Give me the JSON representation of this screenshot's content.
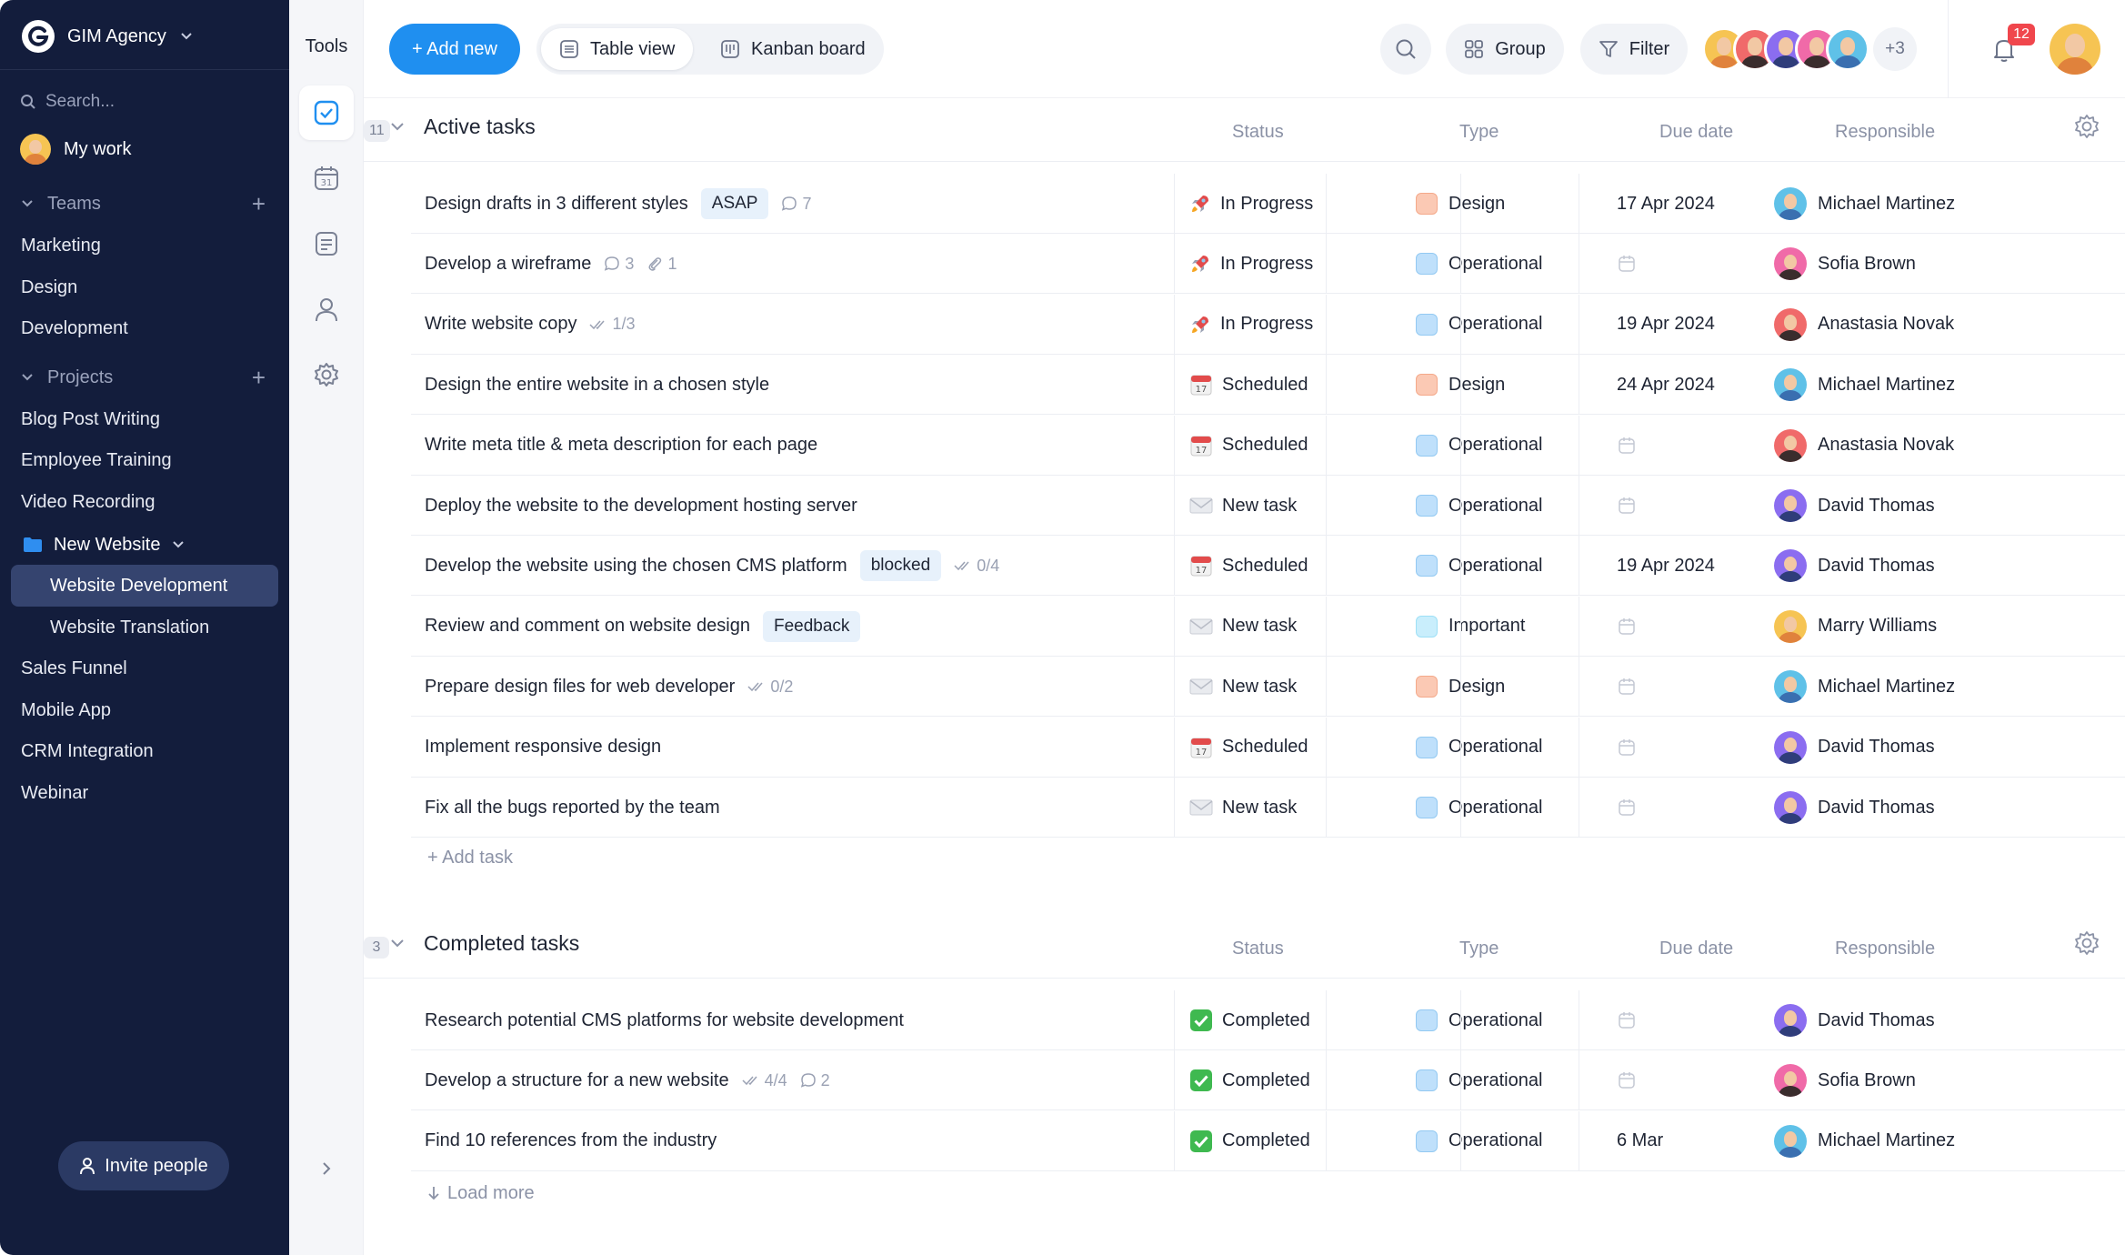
{
  "workspace": {
    "name": "GIM Agency"
  },
  "sidebar": {
    "search_placeholder": "Search...",
    "my_work": "My work",
    "teams_label": "Teams",
    "teams": [
      "Marketing",
      "Design",
      "Development"
    ],
    "projects_label": "Projects",
    "projects_top": [
      "Blog Post Writing",
      "Employee Training",
      "Video Recording"
    ],
    "folder": {
      "name": "New Website",
      "children": [
        "Website Development",
        "Website Translation"
      ],
      "active": "Website Development"
    },
    "projects_bottom": [
      "Sales Funnel",
      "Mobile App",
      "CRM Integration",
      "Webinar"
    ],
    "invite_label": "Invite people"
  },
  "tools": {
    "title": "Tools"
  },
  "topbar": {
    "add_new": "+ Add new",
    "table_view": "Table view",
    "kanban_board": "Kanban board",
    "group": "Group",
    "filter": "Filter",
    "more_members": "+3",
    "notifications": "12"
  },
  "columns": {
    "status": "Status",
    "type": "Type",
    "due": "Due date",
    "responsible": "Responsible"
  },
  "colors": {
    "accent": "#1f8ff0",
    "sidebar_bg": "#131d3c",
    "type_design": "#fbc9b4",
    "type_operational": "#bfe0fb",
    "type_important": "#c9eefc"
  },
  "active_group": {
    "title": "Active tasks",
    "count": "11",
    "add_task": "+ Add task",
    "rows": [
      {
        "name": "Design drafts in 3 different styles",
        "tag": "ASAP",
        "meta": [
          {
            "icon": "comment-icon",
            "text": "7"
          }
        ],
        "status": "In Progress",
        "status_icon": "rocket-icon",
        "type": "Design",
        "due": "17 Apr 2024",
        "resp": "Michael Martinez"
      },
      {
        "name": "Develop a wireframe",
        "tag": "",
        "meta": [
          {
            "icon": "comment-icon",
            "text": "3"
          },
          {
            "icon": "paperclip-icon",
            "text": "1"
          }
        ],
        "status": "In Progress",
        "status_icon": "rocket-icon",
        "type": "Operational",
        "due": "",
        "resp": "Sofia Brown"
      },
      {
        "name": "Write website copy",
        "tag": "",
        "meta": [
          {
            "icon": "checklist-icon",
            "text": "1/3"
          }
        ],
        "status": "In Progress",
        "status_icon": "rocket-icon",
        "type": "Operational",
        "due": "19 Apr 2024",
        "resp": "Anastasia Novak"
      },
      {
        "name": "Design the entire website in a chosen style",
        "tag": "",
        "meta": [],
        "status": "Scheduled",
        "status_icon": "calendar-icon",
        "type": "Design",
        "due": "24 Apr 2024",
        "resp": "Michael Martinez"
      },
      {
        "name": "Write meta title & meta description for each page",
        "tag": "",
        "meta": [],
        "status": "Scheduled",
        "status_icon": "calendar-icon",
        "type": "Operational",
        "due": "",
        "resp": "Anastasia Novak"
      },
      {
        "name": "Deploy the website to the development hosting server",
        "tag": "",
        "meta": [],
        "status": "New task",
        "status_icon": "envelope-icon",
        "type": "Operational",
        "due": "",
        "resp": "David Thomas"
      },
      {
        "name": "Develop the website using the chosen CMS platform",
        "tag": "blocked",
        "meta": [
          {
            "icon": "checklist-icon",
            "text": "0/4"
          }
        ],
        "status": "Scheduled",
        "status_icon": "calendar-icon",
        "type": "Operational",
        "due": "19 Apr 2024",
        "resp": "David Thomas"
      },
      {
        "name": "Review and comment on website design",
        "tag": "Feedback",
        "meta": [],
        "status": "New task",
        "status_icon": "envelope-icon",
        "type": "Important",
        "due": "",
        "resp": "Marry Williams"
      },
      {
        "name": "Prepare design files for web developer",
        "tag": "",
        "meta": [
          {
            "icon": "checklist-icon",
            "text": "0/2"
          }
        ],
        "status": "New task",
        "status_icon": "envelope-icon",
        "type": "Design",
        "due": "",
        "resp": "Michael Martinez"
      },
      {
        "name": "Implement responsive design",
        "tag": "",
        "meta": [],
        "status": "Scheduled",
        "status_icon": "calendar-icon",
        "type": "Operational",
        "due": "",
        "resp": "David Thomas"
      },
      {
        "name": "Fix all the bugs reported by the team",
        "tag": "",
        "meta": [],
        "status": "New task",
        "status_icon": "envelope-icon",
        "type": "Operational",
        "due": "",
        "resp": "David Thomas"
      }
    ]
  },
  "completed_group": {
    "title": "Completed tasks",
    "count": "3",
    "load_more": "Load more",
    "rows": [
      {
        "name": "Research potential CMS platforms for website development",
        "tag": "",
        "meta": [],
        "status": "Completed",
        "status_icon": "check-icon",
        "type": "Operational",
        "due": "",
        "resp": "David Thomas"
      },
      {
        "name": "Develop a structure for a new website",
        "tag": "",
        "meta": [
          {
            "icon": "checklist-icon",
            "text": "4/4"
          },
          {
            "icon": "comment-icon",
            "text": "2"
          }
        ],
        "status": "Completed",
        "status_icon": "check-icon",
        "type": "Operational",
        "due": "",
        "resp": "Sofia Brown"
      },
      {
        "name": "Find 10 references from the industry",
        "tag": "",
        "meta": [],
        "status": "Completed",
        "status_icon": "check-icon",
        "type": "Operational",
        "due": "6 Mar",
        "resp": "Michael Martinez"
      }
    ]
  }
}
